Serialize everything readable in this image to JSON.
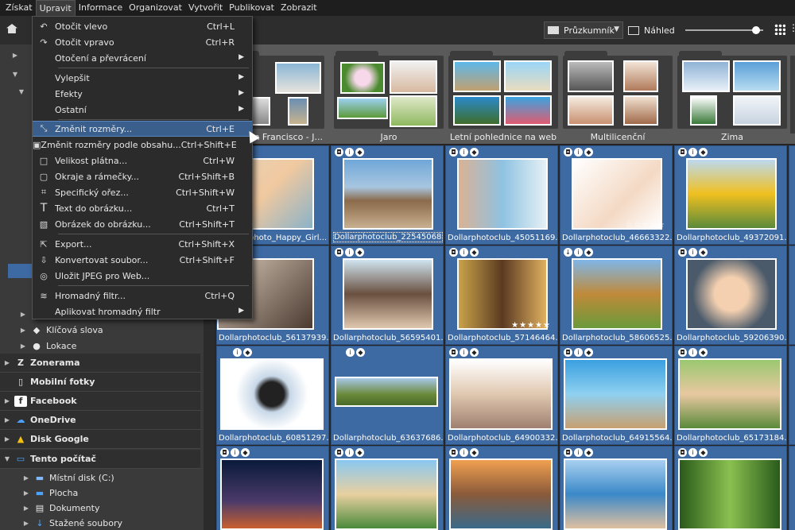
{
  "menubar": [
    "Získat",
    "Upravit",
    "Informace",
    "Organizovat",
    "Vytvořit",
    "Publikovat",
    "Zobrazit"
  ],
  "toolbar": {
    "explorer_label": "Průzkumník",
    "preview_label": "Náhled"
  },
  "dropdown": {
    "items": [
      {
        "label": "Otočit vlevo",
        "shortcut": "Ctrl+L",
        "icon": "rotate-left-icon"
      },
      {
        "label": "Otočit vpravo",
        "shortcut": "Ctrl+R",
        "icon": "rotate-right-icon"
      },
      {
        "label": "Otočení a převrácení",
        "submenu": true
      },
      {
        "label": "Vylepšit",
        "submenu": true
      },
      {
        "label": "Efekty",
        "submenu": true
      },
      {
        "label": "Ostatní",
        "submenu": true
      },
      {
        "label": "Změnit rozměry...",
        "shortcut": "Ctrl+E",
        "icon": "resize-icon",
        "highlighted": true
      },
      {
        "label": "Změnit rozměry podle obsahu...",
        "shortcut": "Ctrl+Shift+E",
        "icon": "smart-resize-icon"
      },
      {
        "label": "Velikost plátna...",
        "shortcut": "Ctrl+W",
        "icon": "canvas-size-icon"
      },
      {
        "label": "Okraje a rámečky...",
        "shortcut": "Ctrl+Shift+B",
        "icon": "frame-icon"
      },
      {
        "label": "Specifický ořez...",
        "shortcut": "Ctrl+Shift+W",
        "icon": "crop-icon"
      },
      {
        "label": "Text do obrázku...",
        "shortcut": "Ctrl+T",
        "icon": "text-icon"
      },
      {
        "label": "Obrázek do obrázku...",
        "shortcut": "Ctrl+Shift+T",
        "icon": "image-in-image-icon"
      },
      {
        "label": "Export...",
        "shortcut": "Ctrl+Shift+X",
        "icon": "export-icon"
      },
      {
        "label": "Konvertovat soubor...",
        "shortcut": "Ctrl+Shift+F",
        "icon": "convert-icon"
      },
      {
        "label": "Uložit JPEG pro Web...",
        "icon": "save-web-icon"
      },
      {
        "label": "Hromadný filtr...",
        "shortcut": "Ctrl+Q",
        "icon": "batch-filter-icon"
      },
      {
        "label": "Aplikovat hromadný filtr",
        "submenu": true
      }
    ]
  },
  "sidebar": {
    "items": [
      {
        "label": "Klíčová slova",
        "icon": "tag-icon"
      },
      {
        "label": "Lokace",
        "icon": "location-icon"
      },
      {
        "label": "Zonerama",
        "icon": "zonerama-icon",
        "section": true
      },
      {
        "label": "Mobilní fotky",
        "icon": "phone-icon",
        "section": true
      },
      {
        "label": "Facebook",
        "icon": "facebook-icon",
        "section": true
      },
      {
        "label": "OneDrive",
        "icon": "onedrive-icon",
        "section": true
      },
      {
        "label": "Disk Google",
        "icon": "google-drive-icon",
        "section": true
      },
      {
        "label": "Tento počítač",
        "icon": "computer-icon",
        "section": true
      },
      {
        "label": "Místní disk (C:)",
        "icon": "drive-icon"
      },
      {
        "label": "Plocha",
        "icon": "desktop-icon"
      },
      {
        "label": "Dokumenty",
        "icon": "documents-icon"
      },
      {
        "label": "Stažené soubory",
        "icon": "download-icon"
      }
    ]
  },
  "folders": [
    "San Francisco - J...",
    "Jaro",
    "Letní pohlednice na web",
    "Multilicenční",
    "Zima"
  ],
  "tiles": [
    {
      "caption": "photo_Happy_Girl..."
    },
    {
      "caption": "Dollarphotoclub_22545068....",
      "selected": true
    },
    {
      "caption": "Dollarphotoclub_45051169...."
    },
    {
      "caption": "Dollarphotoclub_46663322....",
      "stars": "☆☆☆☆☆"
    },
    {
      "caption": "Dollarphotoclub_49372091...."
    },
    {
      "caption": "Dollarphotoclub_56137939...."
    },
    {
      "caption": "Dollarphotoclub_56595401...."
    },
    {
      "caption": "Dollarphotoclub_57146464....",
      "stars": "★★★★★"
    },
    {
      "caption": "Dollarphotoclub_58606525...."
    },
    {
      "caption": "Dollarphotoclub_59206390...."
    },
    {
      "caption": "Dollarphotoclub_60851297...."
    },
    {
      "caption": "Dollarphotoclub_63637686...."
    },
    {
      "caption": "Dollarphotoclub_64900332...."
    },
    {
      "caption": "Dollarphotoclub_64915564...."
    },
    {
      "caption": "Dollarphotoclub_65173184...."
    },
    {
      "caption": ""
    },
    {
      "caption": ""
    },
    {
      "caption": ""
    },
    {
      "caption": "",
      "stars": "★★★"
    },
    {
      "caption": ""
    }
  ],
  "colors": {
    "accent": "#3d6aa3",
    "highlight": "#3a5f8c"
  }
}
